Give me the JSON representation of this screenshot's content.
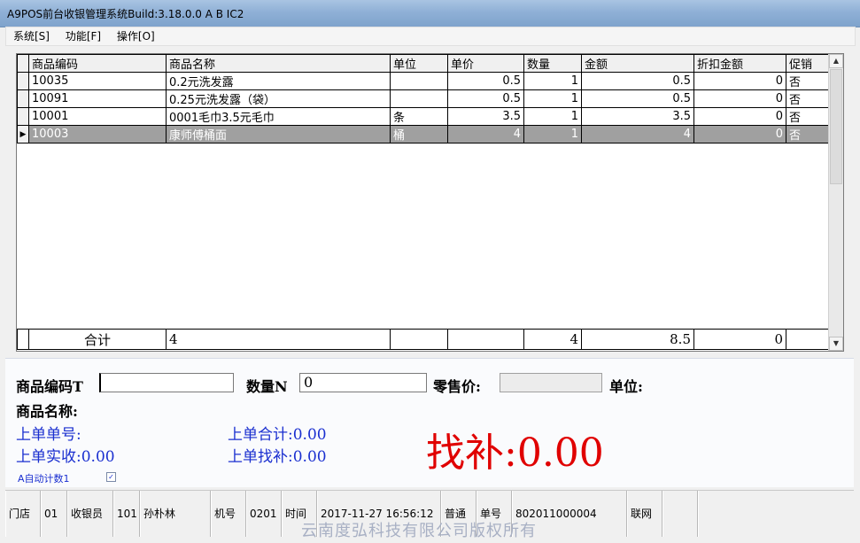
{
  "window": {
    "title": "A9POS前台收银管理系统Build:3.18.0.0 A B IC2"
  },
  "menu": [
    {
      "label": "系统[S]"
    },
    {
      "label": "功能[F]"
    },
    {
      "label": "操作[O]"
    }
  ],
  "grid": {
    "columns": [
      "商品编码",
      "商品名称",
      "单位",
      "单价",
      "数量",
      "金额",
      "折扣金额",
      "促销"
    ],
    "rows": [
      {
        "code": "10035",
        "name": "0.2元洗发露",
        "unit": "",
        "price": "0.5",
        "qty": "1",
        "amount": "0.5",
        "discount": "0",
        "promo": "否",
        "selected": false
      },
      {
        "code": "10091",
        "name": "0.25元洗发露（袋）",
        "unit": "",
        "price": "0.5",
        "qty": "1",
        "amount": "0.5",
        "discount": "0",
        "promo": "否",
        "selected": false
      },
      {
        "code": "10001",
        "name": "0001毛巾3.5元毛巾",
        "unit": "条",
        "price": "3.5",
        "qty": "1",
        "amount": "3.5",
        "discount": "0",
        "promo": "否",
        "selected": false
      },
      {
        "code": "10003",
        "name": "康师傅桶面",
        "unit": "桶",
        "price": "4",
        "qty": "1",
        "amount": "4",
        "discount": "0",
        "promo": "否",
        "selected": true
      }
    ],
    "totals": {
      "label": "合计",
      "count": "4",
      "qty": "4",
      "amount": "8.5",
      "discount": "0"
    }
  },
  "entry": {
    "code_label": "商品编码T",
    "code_value": "",
    "qty_label": "数量N",
    "qty_value": "0",
    "price_label": "零售价:",
    "price_value": "",
    "unit_label": "单位:",
    "name_label": "商品名称:"
  },
  "last_order": {
    "no_label": "上单单号:",
    "received": "上单实收:0.00",
    "total": "上单合计:0.00",
    "change": "上单找补:0.00"
  },
  "change_display": "找补:0.00",
  "auto_count": {
    "label": "A自动计数1",
    "checked": true
  },
  "status": {
    "store_label": "门店",
    "store": "01",
    "cashier_label": "收银员",
    "cashier_id": "101",
    "cashier_name": "孙朴林",
    "machine_label": "机号",
    "machine": "0201",
    "time_label": "时间",
    "time": "2017-11-27 16:56:12",
    "mode": "普通",
    "order_label": "单号",
    "order": "802011000004",
    "network": "联网"
  },
  "watermark": "云南度弘科技有限公司版权所有",
  "colors": {
    "selected_row": "#a0a0a0",
    "change_text": "#e00000",
    "info_text": "#1a2fd0"
  }
}
